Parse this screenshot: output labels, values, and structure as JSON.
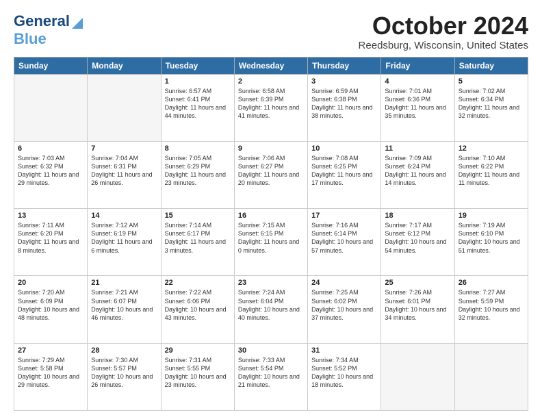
{
  "header": {
    "logo_general": "General",
    "logo_blue": "Blue",
    "month_title": "October 2024",
    "location": "Reedsburg, Wisconsin, United States"
  },
  "days_of_week": [
    "Sunday",
    "Monday",
    "Tuesday",
    "Wednesday",
    "Thursday",
    "Friday",
    "Saturday"
  ],
  "weeks": [
    [
      {
        "day": "",
        "sunrise": "",
        "sunset": "",
        "daylight": "",
        "empty": true
      },
      {
        "day": "",
        "sunrise": "",
        "sunset": "",
        "daylight": "",
        "empty": true
      },
      {
        "day": "1",
        "sunrise": "Sunrise: 6:57 AM",
        "sunset": "Sunset: 6:41 PM",
        "daylight": "Daylight: 11 hours and 44 minutes.",
        "empty": false
      },
      {
        "day": "2",
        "sunrise": "Sunrise: 6:58 AM",
        "sunset": "Sunset: 6:39 PM",
        "daylight": "Daylight: 11 hours and 41 minutes.",
        "empty": false
      },
      {
        "day": "3",
        "sunrise": "Sunrise: 6:59 AM",
        "sunset": "Sunset: 6:38 PM",
        "daylight": "Daylight: 11 hours and 38 minutes.",
        "empty": false
      },
      {
        "day": "4",
        "sunrise": "Sunrise: 7:01 AM",
        "sunset": "Sunset: 6:36 PM",
        "daylight": "Daylight: 11 hours and 35 minutes.",
        "empty": false
      },
      {
        "day": "5",
        "sunrise": "Sunrise: 7:02 AM",
        "sunset": "Sunset: 6:34 PM",
        "daylight": "Daylight: 11 hours and 32 minutes.",
        "empty": false
      }
    ],
    [
      {
        "day": "6",
        "sunrise": "Sunrise: 7:03 AM",
        "sunset": "Sunset: 6:32 PM",
        "daylight": "Daylight: 11 hours and 29 minutes.",
        "empty": false
      },
      {
        "day": "7",
        "sunrise": "Sunrise: 7:04 AM",
        "sunset": "Sunset: 6:31 PM",
        "daylight": "Daylight: 11 hours and 26 minutes.",
        "empty": false
      },
      {
        "day": "8",
        "sunrise": "Sunrise: 7:05 AM",
        "sunset": "Sunset: 6:29 PM",
        "daylight": "Daylight: 11 hours and 23 minutes.",
        "empty": false
      },
      {
        "day": "9",
        "sunrise": "Sunrise: 7:06 AM",
        "sunset": "Sunset: 6:27 PM",
        "daylight": "Daylight: 11 hours and 20 minutes.",
        "empty": false
      },
      {
        "day": "10",
        "sunrise": "Sunrise: 7:08 AM",
        "sunset": "Sunset: 6:25 PM",
        "daylight": "Daylight: 11 hours and 17 minutes.",
        "empty": false
      },
      {
        "day": "11",
        "sunrise": "Sunrise: 7:09 AM",
        "sunset": "Sunset: 6:24 PM",
        "daylight": "Daylight: 11 hours and 14 minutes.",
        "empty": false
      },
      {
        "day": "12",
        "sunrise": "Sunrise: 7:10 AM",
        "sunset": "Sunset: 6:22 PM",
        "daylight": "Daylight: 11 hours and 11 minutes.",
        "empty": false
      }
    ],
    [
      {
        "day": "13",
        "sunrise": "Sunrise: 7:11 AM",
        "sunset": "Sunset: 6:20 PM",
        "daylight": "Daylight: 11 hours and 8 minutes.",
        "empty": false
      },
      {
        "day": "14",
        "sunrise": "Sunrise: 7:12 AM",
        "sunset": "Sunset: 6:19 PM",
        "daylight": "Daylight: 11 hours and 6 minutes.",
        "empty": false
      },
      {
        "day": "15",
        "sunrise": "Sunrise: 7:14 AM",
        "sunset": "Sunset: 6:17 PM",
        "daylight": "Daylight: 11 hours and 3 minutes.",
        "empty": false
      },
      {
        "day": "16",
        "sunrise": "Sunrise: 7:15 AM",
        "sunset": "Sunset: 6:15 PM",
        "daylight": "Daylight: 11 hours and 0 minutes.",
        "empty": false
      },
      {
        "day": "17",
        "sunrise": "Sunrise: 7:16 AM",
        "sunset": "Sunset: 6:14 PM",
        "daylight": "Daylight: 10 hours and 57 minutes.",
        "empty": false
      },
      {
        "day": "18",
        "sunrise": "Sunrise: 7:17 AM",
        "sunset": "Sunset: 6:12 PM",
        "daylight": "Daylight: 10 hours and 54 minutes.",
        "empty": false
      },
      {
        "day": "19",
        "sunrise": "Sunrise: 7:19 AM",
        "sunset": "Sunset: 6:10 PM",
        "daylight": "Daylight: 10 hours and 51 minutes.",
        "empty": false
      }
    ],
    [
      {
        "day": "20",
        "sunrise": "Sunrise: 7:20 AM",
        "sunset": "Sunset: 6:09 PM",
        "daylight": "Daylight: 10 hours and 48 minutes.",
        "empty": false
      },
      {
        "day": "21",
        "sunrise": "Sunrise: 7:21 AM",
        "sunset": "Sunset: 6:07 PM",
        "daylight": "Daylight: 10 hours and 46 minutes.",
        "empty": false
      },
      {
        "day": "22",
        "sunrise": "Sunrise: 7:22 AM",
        "sunset": "Sunset: 6:06 PM",
        "daylight": "Daylight: 10 hours and 43 minutes.",
        "empty": false
      },
      {
        "day": "23",
        "sunrise": "Sunrise: 7:24 AM",
        "sunset": "Sunset: 6:04 PM",
        "daylight": "Daylight: 10 hours and 40 minutes.",
        "empty": false
      },
      {
        "day": "24",
        "sunrise": "Sunrise: 7:25 AM",
        "sunset": "Sunset: 6:02 PM",
        "daylight": "Daylight: 10 hours and 37 minutes.",
        "empty": false
      },
      {
        "day": "25",
        "sunrise": "Sunrise: 7:26 AM",
        "sunset": "Sunset: 6:01 PM",
        "daylight": "Daylight: 10 hours and 34 minutes.",
        "empty": false
      },
      {
        "day": "26",
        "sunrise": "Sunrise: 7:27 AM",
        "sunset": "Sunset: 5:59 PM",
        "daylight": "Daylight: 10 hours and 32 minutes.",
        "empty": false
      }
    ],
    [
      {
        "day": "27",
        "sunrise": "Sunrise: 7:29 AM",
        "sunset": "Sunset: 5:58 PM",
        "daylight": "Daylight: 10 hours and 29 minutes.",
        "empty": false
      },
      {
        "day": "28",
        "sunrise": "Sunrise: 7:30 AM",
        "sunset": "Sunset: 5:57 PM",
        "daylight": "Daylight: 10 hours and 26 minutes.",
        "empty": false
      },
      {
        "day": "29",
        "sunrise": "Sunrise: 7:31 AM",
        "sunset": "Sunset: 5:55 PM",
        "daylight": "Daylight: 10 hours and 23 minutes.",
        "empty": false
      },
      {
        "day": "30",
        "sunrise": "Sunrise: 7:33 AM",
        "sunset": "Sunset: 5:54 PM",
        "daylight": "Daylight: 10 hours and 21 minutes.",
        "empty": false
      },
      {
        "day": "31",
        "sunrise": "Sunrise: 7:34 AM",
        "sunset": "Sunset: 5:52 PM",
        "daylight": "Daylight: 10 hours and 18 minutes.",
        "empty": false
      },
      {
        "day": "",
        "sunrise": "",
        "sunset": "",
        "daylight": "",
        "empty": true
      },
      {
        "day": "",
        "sunrise": "",
        "sunset": "",
        "daylight": "",
        "empty": true
      }
    ]
  ]
}
